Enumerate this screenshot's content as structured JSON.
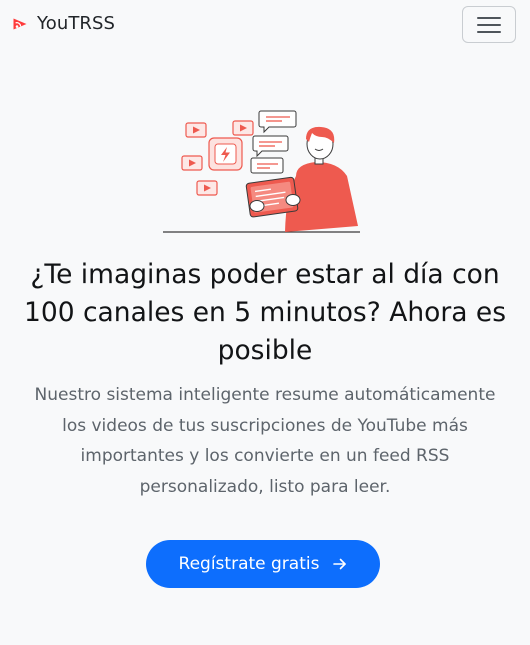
{
  "navbar": {
    "brand": "YouTRSS",
    "logo_icon": "youtube-rss-logo-icon",
    "menu_icon": "hamburger-menu-icon"
  },
  "hero": {
    "illustration": "person-reading-video-summaries-illustration",
    "title": "¿Te imaginas poder estar al día con 100 canales en 5 minutos? Ahora es posible",
    "description": "Nuestro sistema inteligente resume automáticamente los videos de tus suscripciones de YouTube más importantes y los convierte en un feed RSS personalizado, listo para leer.",
    "cta_label": "Regístrate gratis",
    "cta_icon": "arrow-right-icon"
  },
  "colors": {
    "brand_red": "#ff3b3b",
    "primary_blue": "#0d6efd",
    "background": "#f8f9fa",
    "illustration_coral": "#ee5a4f"
  }
}
